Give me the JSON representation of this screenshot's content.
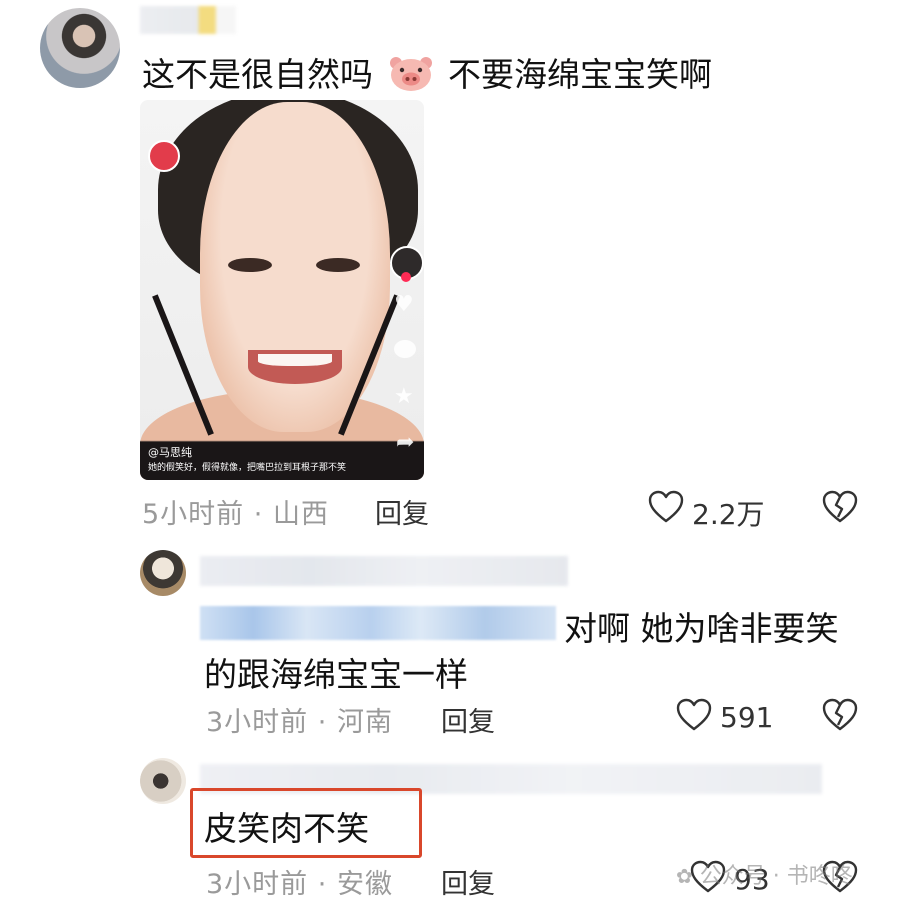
{
  "comment1": {
    "text_part1": "这不是很自然吗",
    "emoji": "pig-face-emoji",
    "text_part2": "不要海绵宝宝笑啊",
    "video_overlay": {
      "author": "@马思纯",
      "caption": "她的假笑好，假得就像，把嘴巴拉到耳根子那不笑"
    },
    "time": "5小时前",
    "sep": "·",
    "location": "山西",
    "reply_label": "回复",
    "likes": "2.2万"
  },
  "reply1": {
    "text_line1": "对啊 她为啥非要笑",
    "text_line2": "的跟海绵宝宝一样",
    "time": "3小时前",
    "sep": "·",
    "location": "河南",
    "reply_label": "回复",
    "likes": "591"
  },
  "reply2": {
    "text": "皮笑肉不笑",
    "highlight_color": "#d9472b",
    "time": "3小时前",
    "sep": "·",
    "location": "安徽",
    "reply_label": "回复",
    "likes": "93"
  },
  "watermark": {
    "text": "公众号 · 书咚咚"
  }
}
